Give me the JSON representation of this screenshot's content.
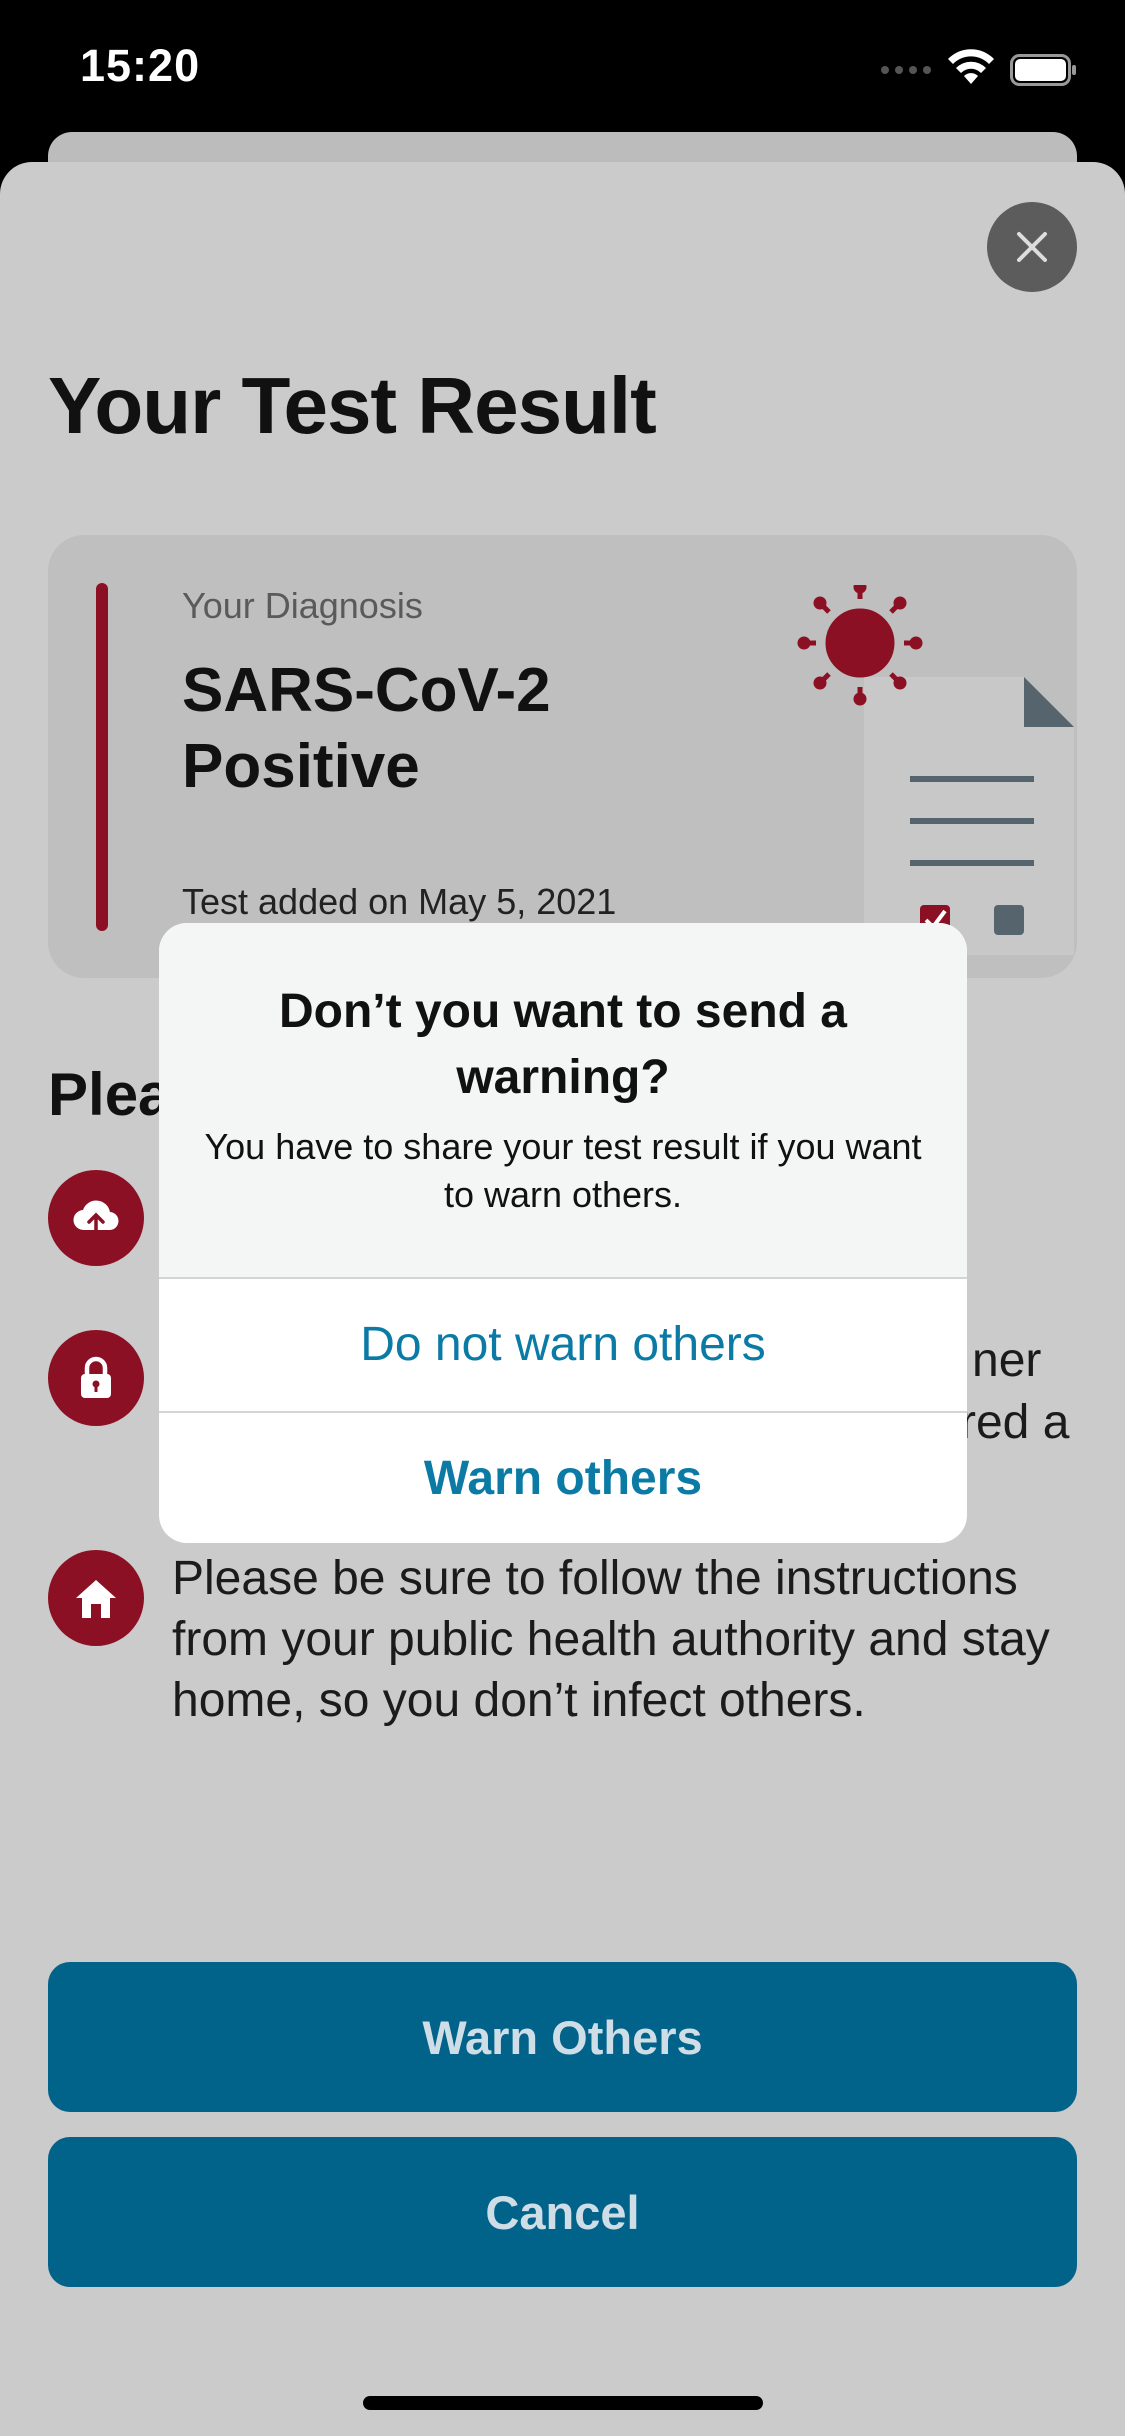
{
  "status_bar": {
    "time": "15:20"
  },
  "screen": {
    "title": "Your Test Result",
    "diagnosis": {
      "label": "Your Diagnosis",
      "result": "SARS-CoV-2 Positive",
      "date": "Test added on May 5, 2021"
    },
    "section_heading_partial": "Plea",
    "instructions": [
      {
        "icon": "upload-cloud-icon",
        "text": ""
      },
      {
        "icon": "lock-icon",
        "text_visible_fragment_1": "ner",
        "text_visible_fragment_2": "red a"
      },
      {
        "icon": "home-icon",
        "text": "Please be sure to follow the instructions from your public health authority and stay home, so you don’t infect others."
      }
    ],
    "buttons": {
      "warn_others": "Warn Others",
      "cancel": "Cancel"
    }
  },
  "alert": {
    "title": "Don’t you want to send a warning?",
    "message": "You have to share your test result if you want to warn others.",
    "actions": {
      "do_not_warn": "Do not warn others",
      "warn": "Warn others"
    }
  },
  "colors": {
    "accent_red": "#8c1024",
    "button_blue": "#01638a",
    "link_blue": "#0b7ba6"
  }
}
